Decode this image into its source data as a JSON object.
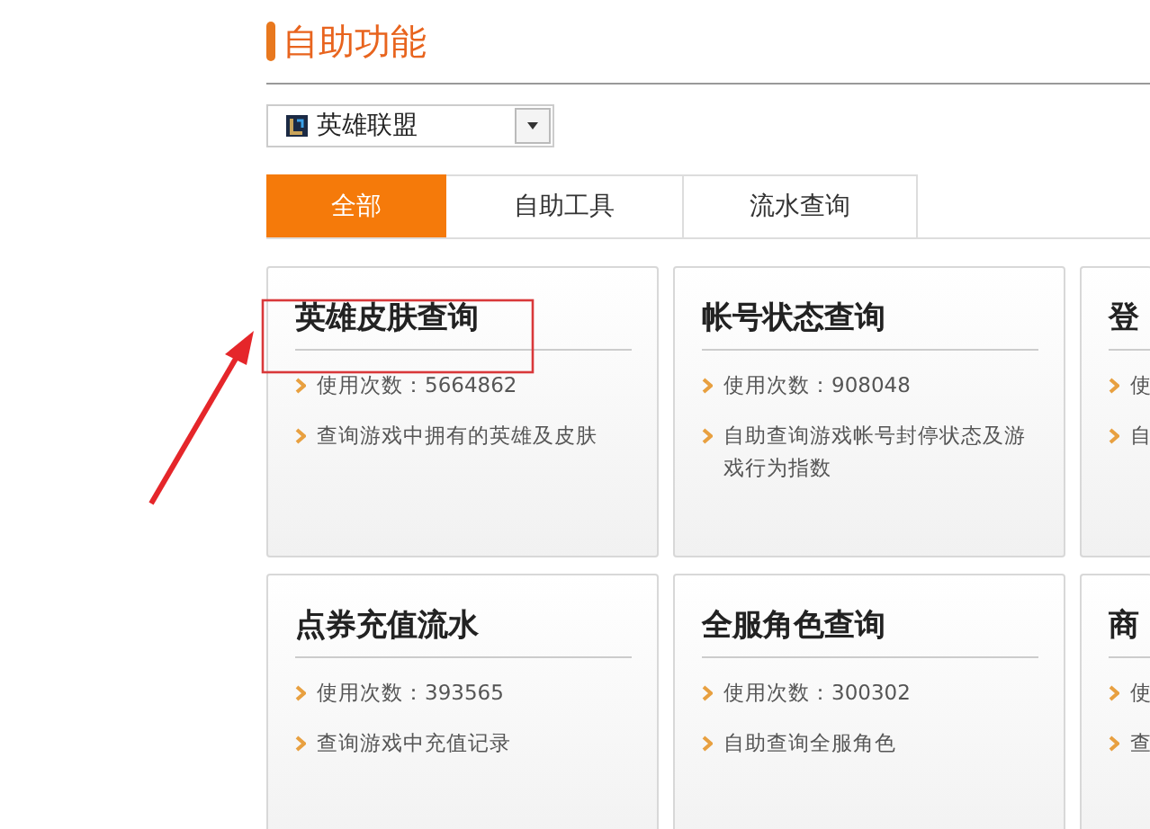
{
  "header": {
    "title": "自助功能"
  },
  "game_select": {
    "value": "英雄联盟"
  },
  "tabs": [
    {
      "label": "全部",
      "selected": true
    },
    {
      "label": "自助工具",
      "selected": false
    },
    {
      "label": "流水查询",
      "selected": false
    }
  ],
  "cards": [
    {
      "title": "英雄皮肤查询",
      "usage": "使用次数：5664862",
      "description": "查询游戏中拥有的英雄及皮肤"
    },
    {
      "title": "帐号状态查询",
      "usage": "使用次数：908048",
      "description": "自助查询游戏帐号封停状态及游戏行为指数"
    },
    {
      "title": "登",
      "usage": "使",
      "description": "自"
    },
    {
      "title": "点券充值流水",
      "usage": "使用次数：393565",
      "description": "查询游戏中充值记录"
    },
    {
      "title": "全服角色查询",
      "usage": "使用次数：300302",
      "description": "自助查询全服角色"
    },
    {
      "title": "商",
      "usage": "使",
      "description": "查"
    }
  ]
}
